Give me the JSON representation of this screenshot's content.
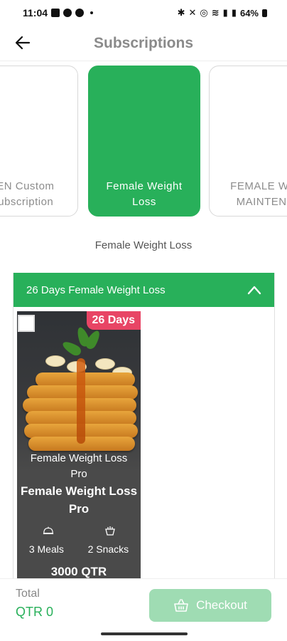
{
  "status_bar": {
    "time": "11:04",
    "battery": "64%"
  },
  "header": {
    "title": "Subscriptions",
    "back_icon": "arrow-left-icon"
  },
  "categories": [
    {
      "label": "ZEN Custom\nSubscription",
      "active": false
    },
    {
      "label": "Female Weight\nLoss",
      "active": true
    },
    {
      "label": "FEMALE WEIG\nMAINTENAN",
      "active": false
    }
  ],
  "selected_category_title": "Female Weight Loss",
  "accordion": {
    "title": "26 Days Female Weight Loss",
    "expanded": true,
    "chevron_icon": "chevron-up-icon"
  },
  "plan": {
    "days_badge": "26 Days",
    "image_caption": "Female Weight Loss\nPro",
    "name": "Female Weight Loss\nPro",
    "meals": "3 Meals",
    "snacks": "2 Snacks",
    "meals_icon": "cloche-icon",
    "snacks_icon": "snack-icon",
    "price": "3000 QTR",
    "selected": false
  },
  "footer": {
    "total_label": "Total",
    "total_value": "QTR 0",
    "checkout_label": "Checkout",
    "checkout_icon": "basket-icon"
  },
  "colors": {
    "brand_green": "#28b05a",
    "badge_pink": "#e84565",
    "checkout_disabled": "#9fdcb3"
  }
}
